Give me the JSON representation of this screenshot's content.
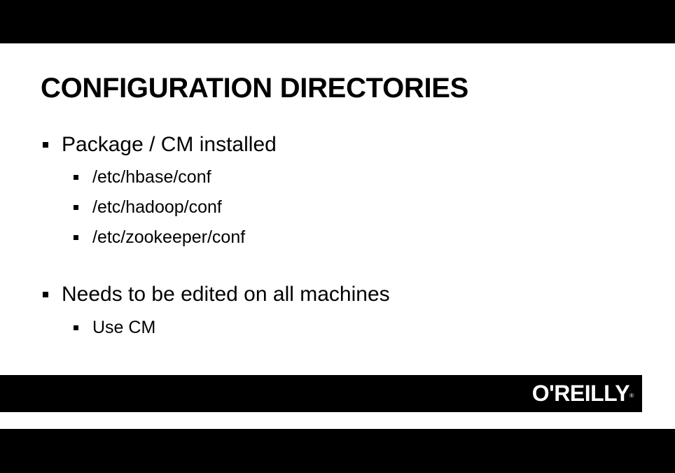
{
  "slide": {
    "title": "CONFIGURATION DIRECTORIES",
    "bullets": [
      {
        "text": "Package / CM installed",
        "sub": [
          "/etc/hbase/conf",
          "/etc/hadoop/conf",
          "/etc/zookeeper/conf"
        ]
      },
      {
        "text": "Needs to be edited on all machines",
        "sub": [
          "Use CM"
        ]
      }
    ]
  },
  "footer": {
    "logo_text": "O'REILLY",
    "logo_mark": "®"
  },
  "colors": {
    "background": "#ffffff",
    "text": "#000000",
    "band": "#000000",
    "logo": "#ffffff"
  }
}
